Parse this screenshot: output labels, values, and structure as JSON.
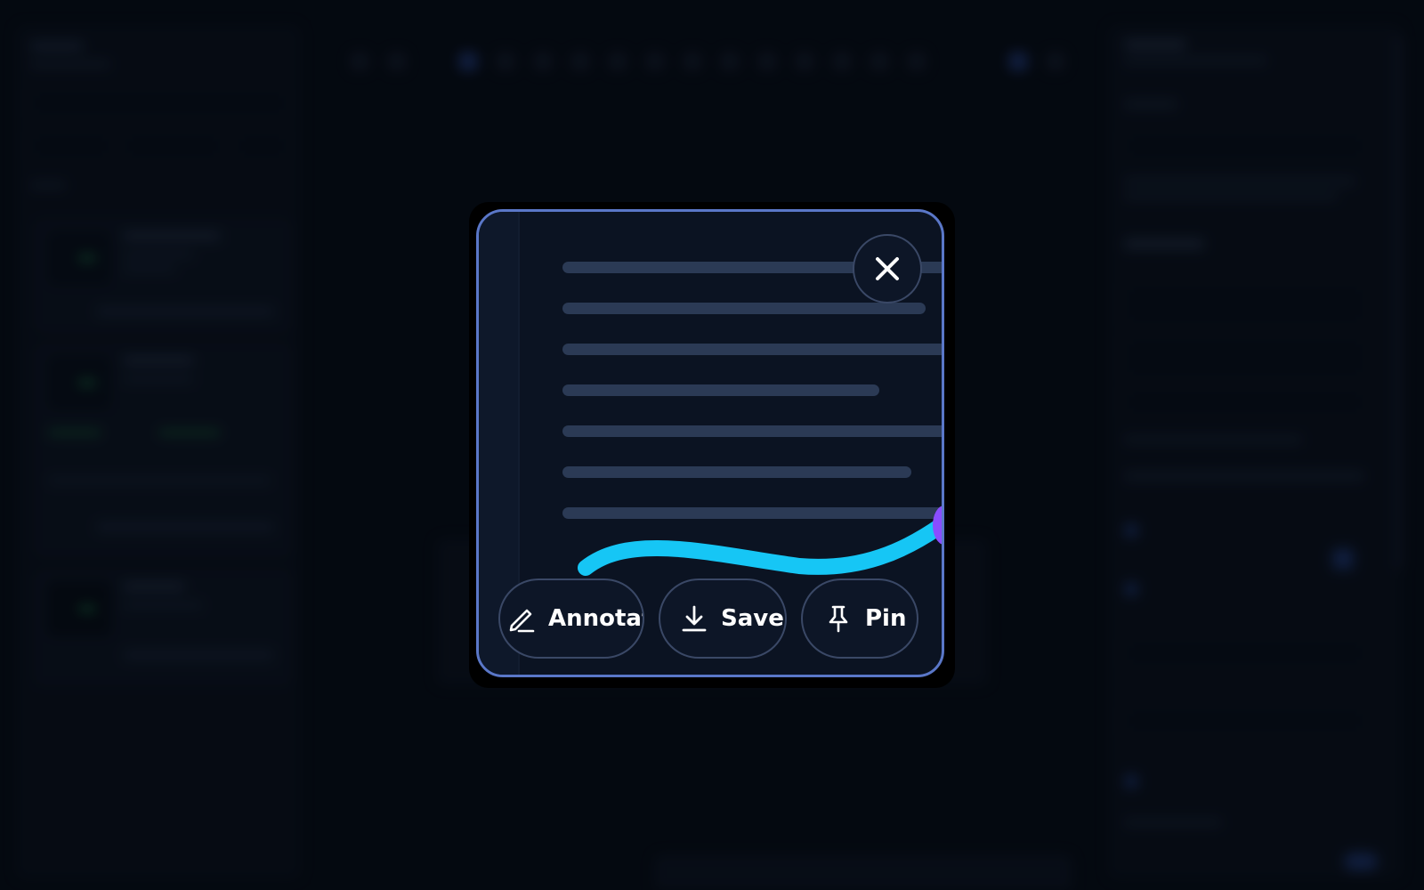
{
  "preview": {
    "close_icon": "close-icon",
    "text_line_count": 7
  },
  "actions": [
    {
      "label": "Annotate",
      "icon": "pencil-icon"
    },
    {
      "label": "Save",
      "icon": "download-icon"
    },
    {
      "label": "Pin",
      "icon": "pin-icon"
    }
  ],
  "colors": {
    "frame_border": "#5a77c8",
    "curve": "#16c6f5",
    "handle": "#8a4dff",
    "preview_background": "#0b1322"
  }
}
